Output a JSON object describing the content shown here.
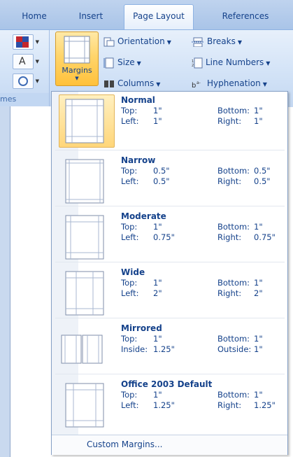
{
  "tabs": [
    {
      "label": "Home",
      "active": false
    },
    {
      "label": "Insert",
      "active": false
    },
    {
      "label": "Page Layout",
      "active": true
    },
    {
      "label": "References",
      "active": false
    }
  ],
  "ribbon": {
    "themes_label": "mes",
    "margins_label": "Margins",
    "commands": {
      "orientation": "Orientation",
      "size": "Size",
      "columns": "Columns",
      "breaks": "Breaks",
      "line_numbers": "Line Numbers",
      "hyphenation": "Hyphenation"
    }
  },
  "menu": {
    "items": [
      {
        "name": "Normal",
        "k1": "Top:",
        "v1": "1\"",
        "k2": "Bottom:",
        "v2": "1\"",
        "k3": "Left:",
        "v3": "1\"",
        "k4": "Right:",
        "v4": "1\""
      },
      {
        "name": "Narrow",
        "k1": "Top:",
        "v1": "0.5\"",
        "k2": "Bottom:",
        "v2": "0.5\"",
        "k3": "Left:",
        "v3": "0.5\"",
        "k4": "Right:",
        "v4": "0.5\""
      },
      {
        "name": "Moderate",
        "k1": "Top:",
        "v1": "1\"",
        "k2": "Bottom:",
        "v2": "1\"",
        "k3": "Left:",
        "v3": "0.75\"",
        "k4": "Right:",
        "v4": "0.75\""
      },
      {
        "name": "Wide",
        "k1": "Top:",
        "v1": "1\"",
        "k2": "Bottom:",
        "v2": "1\"",
        "k3": "Left:",
        "v3": "2\"",
        "k4": "Right:",
        "v4": "2\""
      },
      {
        "name": "Mirrored",
        "k1": "Top:",
        "v1": "1\"",
        "k2": "Bottom:",
        "v2": "1\"",
        "k3": "Inside:",
        "v3": "1.25\"",
        "k4": "Outside:",
        "v4": "1\""
      },
      {
        "name": "Office 2003 Default",
        "k1": "Top:",
        "v1": "1\"",
        "k2": "Bottom:",
        "v2": "1\"",
        "k3": "Left:",
        "v3": "1.25\"",
        "k4": "Right:",
        "v4": "1.25\""
      }
    ],
    "custom_margins": "Custom Margins..."
  }
}
